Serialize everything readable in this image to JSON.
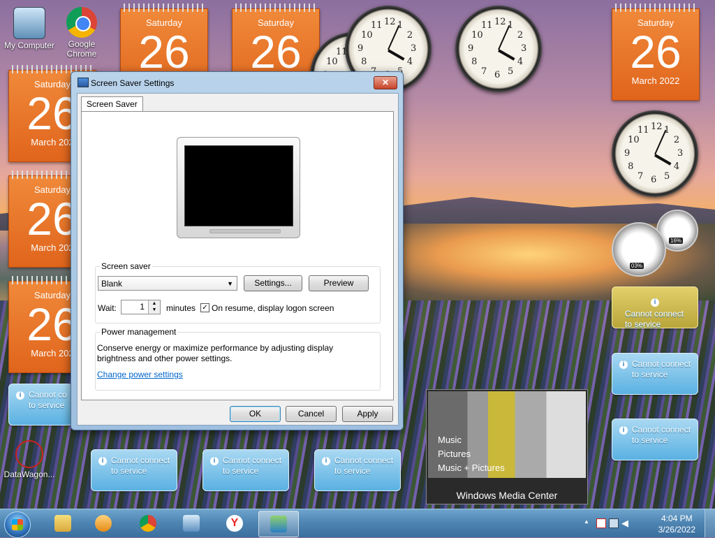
{
  "desktop": {
    "icons": [
      {
        "label": "My Computer"
      },
      {
        "label": "Google Chrome"
      },
      {
        "label": "DataWagon..."
      }
    ],
    "calendar": {
      "day_name": "Saturday",
      "day": "26",
      "month": "March 2022",
      "month_short": "March 202"
    },
    "weather": {
      "text1": "Cannot connect",
      "text2": "to service",
      "text_short": "Cannot co",
      "info_glyph": "i"
    },
    "meters": {
      "cpu": "03%",
      "memory": "16%"
    },
    "clock_numbers": [
      "12",
      "1",
      "2",
      "3",
      "4",
      "5",
      "6",
      "7",
      "8",
      "9",
      "10",
      "11"
    ]
  },
  "media_center": {
    "items": [
      "Music",
      "Pictures",
      "Music + Pictures"
    ],
    "brand": "Windows Media Center"
  },
  "dialog": {
    "title": "Screen Saver Settings",
    "close_glyph": "✕",
    "tab": "Screen Saver",
    "screen_saver": {
      "group_label": "Screen saver",
      "selected": "Blank",
      "settings_button": "Settings...",
      "preview_button": "Preview",
      "wait_label": "Wait:",
      "wait_value": "1",
      "minutes_label": "minutes",
      "resume_checked": true,
      "resume_label": "On resume, display logon screen"
    },
    "power": {
      "group_label": "Power management",
      "description": "Conserve energy or maximize performance by adjusting display brightness and other power settings.",
      "link": "Change power settings"
    },
    "buttons": {
      "ok": "OK",
      "cancel": "Cancel",
      "apply": "Apply"
    }
  },
  "taskbar": {
    "time": "4:04 PM",
    "date": "3/26/2022",
    "tray_arrow": "▲"
  },
  "colors": {
    "calendar_orange": "#e36d24",
    "tile_blue": "#5ab1e2",
    "link": "#0066cc"
  }
}
